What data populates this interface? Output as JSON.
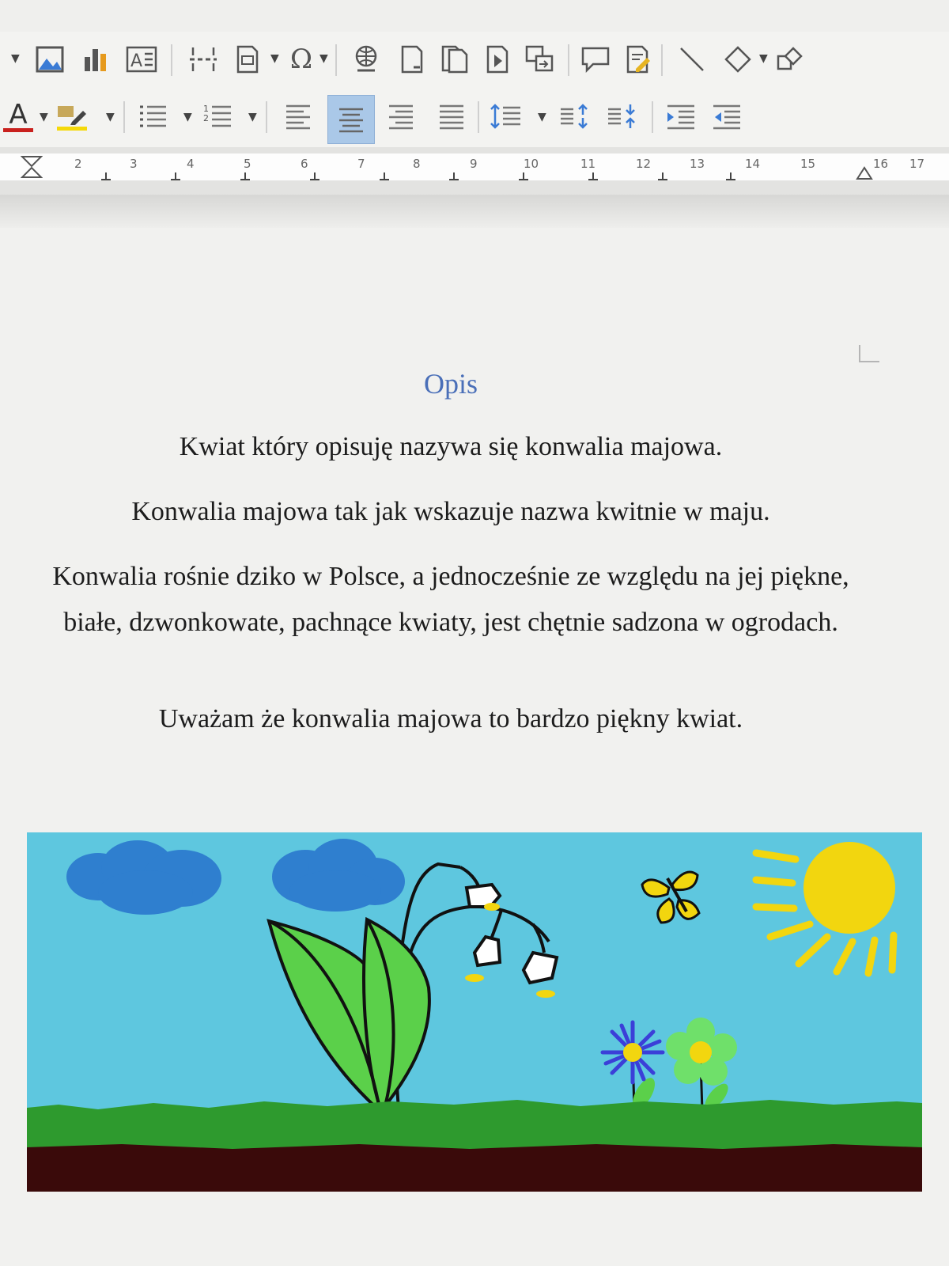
{
  "ruler": {
    "numbers": [
      "2",
      "3",
      "4",
      "5",
      "6",
      "7",
      "8",
      "9",
      "10",
      "11",
      "12",
      "13",
      "14",
      "15",
      "16",
      "17"
    ]
  },
  "toolbar_insert": {
    "icons": [
      "image-icon",
      "chart-icon",
      "textbox-icon",
      "page-break-icon",
      "field-icon",
      "special-character-icon",
      "hyperlink-icon",
      "footnote-icon",
      "endnote-icon",
      "bookmark-icon",
      "cross-reference-icon",
      "comment-icon",
      "track-changes-icon",
      "line-icon",
      "basic-shapes-icon",
      "draw-icon"
    ]
  },
  "toolbar_format": {
    "icons": [
      "font-color-icon",
      "highlight-icon",
      "unordered-list-icon",
      "ordered-list-icon",
      "align-left-icon",
      "align-center-icon",
      "align-right-icon",
      "justify-icon",
      "line-spacing-icon",
      "increase-paragraph-spacing-icon",
      "decrease-paragraph-spacing-icon",
      "increase-indent-icon",
      "decrease-indent-icon"
    ],
    "font_color": "#c9211e",
    "highlight_color": "#f5d90a",
    "active": "align-center"
  },
  "document": {
    "title": "Opis",
    "paragraphs": [
      "Kwiat który opisuję nazywa się konwalia majowa.",
      "Konwalia majowa tak jak wskazuje nazwa kwitnie w maju.",
      "Konwalia rośnie dziko w Polsce, a jednocześnie ze względu na jej piękne, białe, dzwonkowate, pachnące kwiaty, jest chętnie sadzona w ogrodach.",
      "Uważam że konwalia majowa to bardzo piękny kwiat."
    ]
  },
  "picture": {
    "sky_color": "#5ec7df",
    "cloud_color": "#2f7fcf",
    "sun_color": "#f2d60f",
    "grass_color": "#2e9a2e",
    "soil_color": "#3a0a0a",
    "leaf_color": "#5bd04a"
  }
}
